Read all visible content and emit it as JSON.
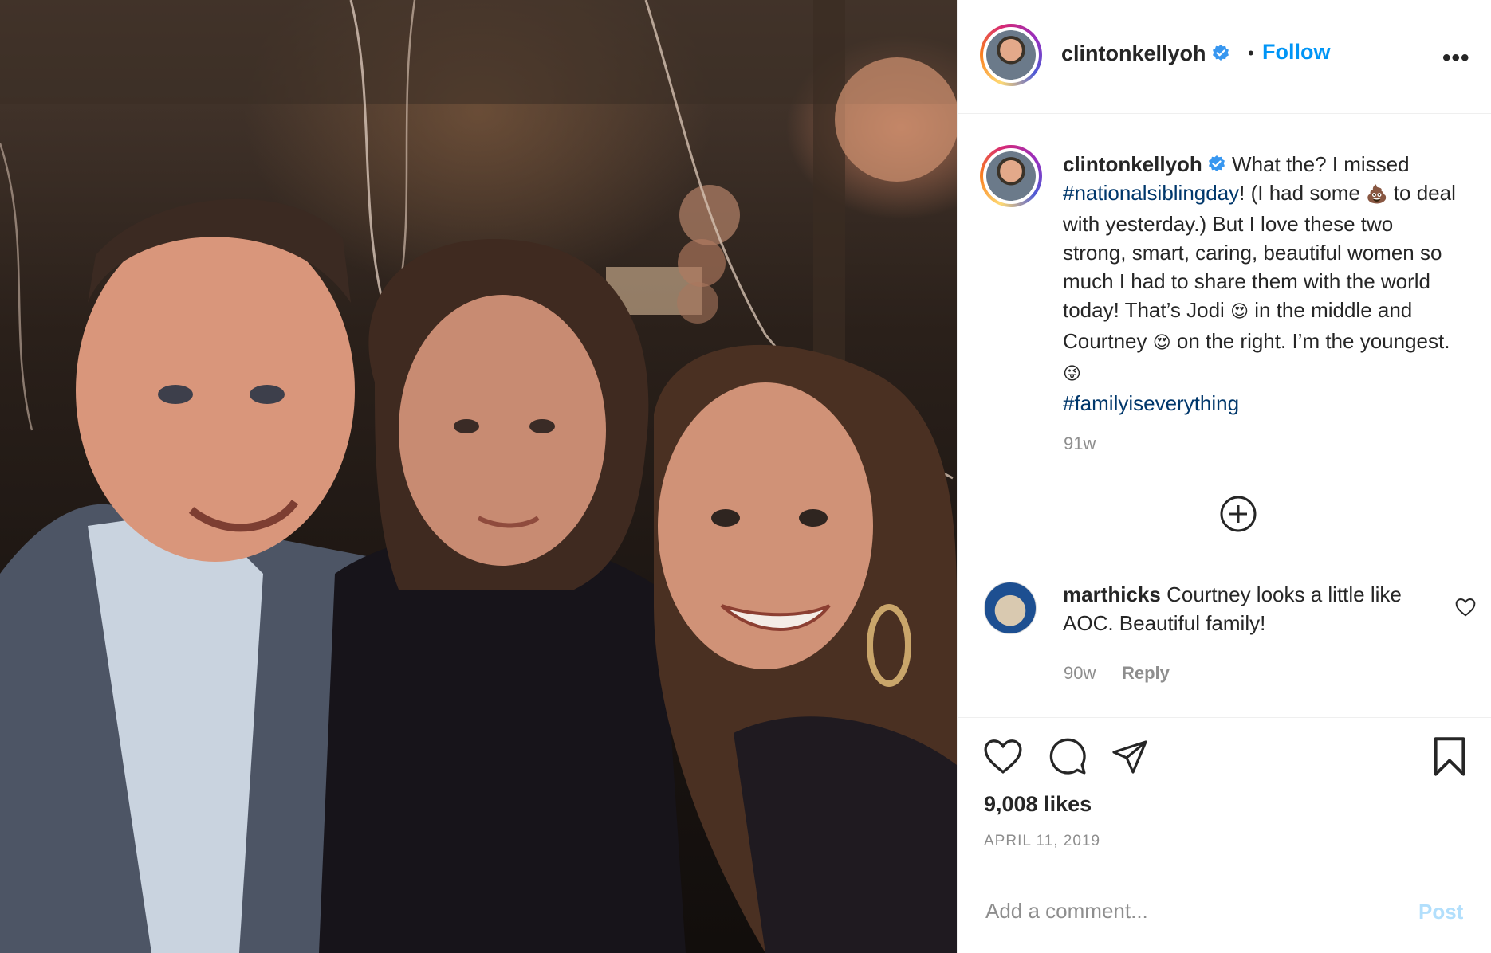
{
  "post": {
    "username": "clintonkellyoh",
    "separator": "•",
    "follow_label": "Follow",
    "more_label": "•••"
  },
  "caption": {
    "username": "clintonkellyoh",
    "text_1": "What the? I missed",
    "hashtag_1": "#nationalsiblingday",
    "text_2": "! (I had some",
    "emoji_poop": "💩",
    "text_3": "to deal with yesterday.) But I love these two strong, smart, caring, beautiful women so much I had to share them with the world today! That’s Jodi",
    "emoji_heart_eyes_1": "😍",
    "text_4": "in the middle and Courtney",
    "emoji_heart_eyes_2": "😍",
    "text_5": "on the right. I’m the youngest.",
    "emoji_wink": "😜",
    "hashtag_2": "#familyiseverything",
    "time": "91w"
  },
  "comments": [
    {
      "username": "marthicks",
      "text": "Courtney looks a little like AOC. Beautiful family!",
      "time": "90w",
      "reply_label": "Reply"
    }
  ],
  "stats": {
    "likes": "9,008 likes",
    "date": "APRIL 11, 2019"
  },
  "add_comment": {
    "placeholder": "Add a comment...",
    "post_label": "Post"
  },
  "colors": {
    "accent": "#0095f6",
    "hashtag": "#00376b",
    "muted": "#8e8e8e",
    "post_disabled": "#b2dffc"
  },
  "icons": [
    "verified-badge-icon",
    "more-options-icon",
    "load-more-comments-icon",
    "like-icon",
    "comment-icon",
    "share-icon",
    "save-icon"
  ]
}
